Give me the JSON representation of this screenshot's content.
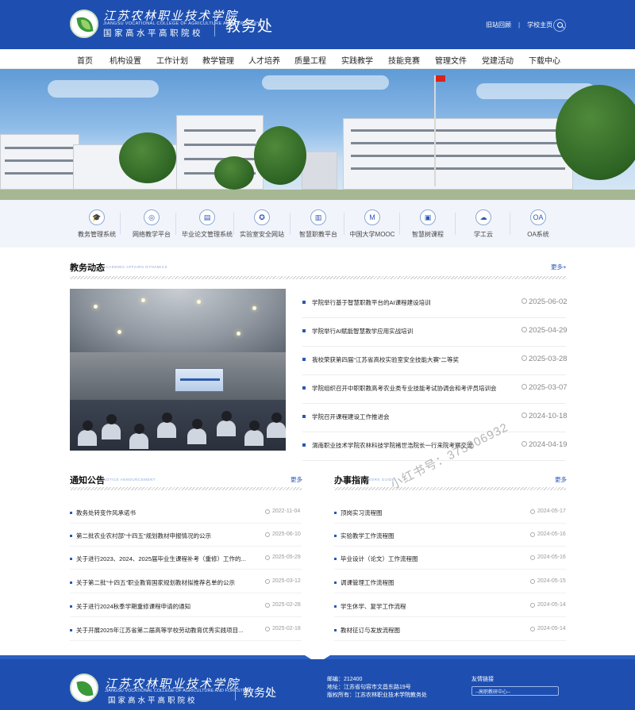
{
  "header": {
    "school_name_cn": "江苏农林职业技术学院",
    "school_name_en": "JIANGSU VOCATIONAL COLLEGE OF AGRICULTURE AND FORESTRY",
    "school_tagline": "国家高水平高职院校",
    "department": "教务处",
    "top_links": [
      "旧站回顾",
      "学校主页"
    ],
    "search_icon": "search-icon"
  },
  "nav": {
    "items": [
      "首页",
      "机构设置",
      "工作计划",
      "教学管理",
      "人才培养",
      "质量工程",
      "实践教学",
      "技能竞赛",
      "管理文件",
      "党建活动",
      "下载中心"
    ]
  },
  "quick_links": [
    {
      "label": "教务管理系统",
      "icon": "graduation-cap-icon",
      "glyph": "🎓"
    },
    {
      "label": "网络教学平台",
      "icon": "globe-icon",
      "glyph": "◎"
    },
    {
      "label": "毕业论文管理系统",
      "icon": "document-icon",
      "glyph": "▤"
    },
    {
      "label": "实验室安全网站",
      "icon": "shield-icon",
      "glyph": "✪"
    },
    {
      "label": "智慧职教平台",
      "icon": "building-icon",
      "glyph": "▥"
    },
    {
      "label": "中国大学MOOC",
      "icon": "mooc-icon",
      "glyph": "M"
    },
    {
      "label": "智慧树课程",
      "icon": "tree-course-icon",
      "glyph": "▣"
    },
    {
      "label": "学工云",
      "icon": "cloud-icon",
      "glyph": "☁"
    },
    {
      "label": "OA系统",
      "icon": "oa-icon",
      "glyph": "OA"
    }
  ],
  "news": {
    "title": "教务动态",
    "subtitle": "ACADEMIC AFFAIRS DYNAMICS",
    "more": "更多+",
    "items": [
      {
        "title": "学院举行基于智慧职教平台的AI课程建设培训",
        "date": "2025-06-02"
      },
      {
        "title": "学院举行AI赋能智慧教学应用实战培训",
        "date": "2025-04-29"
      },
      {
        "title": "我校荣获第四届“江苏省高校实验室安全技能大赛”二等奖",
        "date": "2025-03-28"
      },
      {
        "title": "学院组织召开中职职教高考农业类专业技能考试协调会和考评员培训会",
        "date": "2025-03-07"
      },
      {
        "title": "学院召开课程建设工作推进会",
        "date": "2024-10-18"
      },
      {
        "title": "渭南职业技术学院农林科技学院褚世浩院长一行来院考察交流",
        "date": "2024-04-19"
      }
    ]
  },
  "notice": {
    "title": "通知公告",
    "subtitle": "NOTICE ANNOUNCEMENT",
    "more": "更多",
    "items": [
      {
        "title": "教务处转变作风承诺书",
        "date": "2022-11-04"
      },
      {
        "title": "第二批农业农村部“十四五”规划教材申报情况的公示",
        "date": "2025-06-10"
      },
      {
        "title": "关于进行2023、2024、2025届毕业生课程补考（重修）工作的...",
        "date": "2025-05-29"
      },
      {
        "title": "关于第二批“十四五”职业教育国家规划教材拟推荐名单的公示",
        "date": "2025-03-12"
      },
      {
        "title": "关于进行2024秋季学期重修课程申请的通知",
        "date": "2025-02-28"
      },
      {
        "title": "关于开展2025年江苏省第二届高等学校劳动教育优秀实践项目...",
        "date": "2025-02-18"
      }
    ]
  },
  "guide": {
    "title": "办事指南",
    "subtitle": "WORK GUIDE",
    "more": "更多",
    "items": [
      {
        "title": "顶岗实习流程图",
        "date": "2024-05-17"
      },
      {
        "title": "实验教学工作流程图",
        "date": "2024-05-16"
      },
      {
        "title": "毕业设计（论文）工作流程图",
        "date": "2024-05-16"
      },
      {
        "title": "调课管理工作流程图",
        "date": "2024-05-15"
      },
      {
        "title": "学生休学、复学工作流程",
        "date": "2024-05-14"
      },
      {
        "title": "教材征订与发放流程图",
        "date": "2024-05-14"
      }
    ]
  },
  "watermark": "小红书号：375006932",
  "footer": {
    "school_name_cn": "江苏农林职业技术学院",
    "school_name_en": "JIANGSU VOCATIONAL COLLEGE OF AGRICULTURE AND FORESTRY",
    "school_tagline": "国家高水平高职院校",
    "department": "教务处",
    "postcode": "邮编：212400",
    "address": "地址：江苏省句容市文昌东路19号",
    "copyright": "版权所有：江苏农林职业技术学院教务处",
    "links_title": "友情链接",
    "links_select": "--高职教研中心--"
  },
  "colors": {
    "brand_blue": "#1e4fb0",
    "accent_blue": "#2a57b5",
    "quick_bg": "#f1f5fb"
  }
}
